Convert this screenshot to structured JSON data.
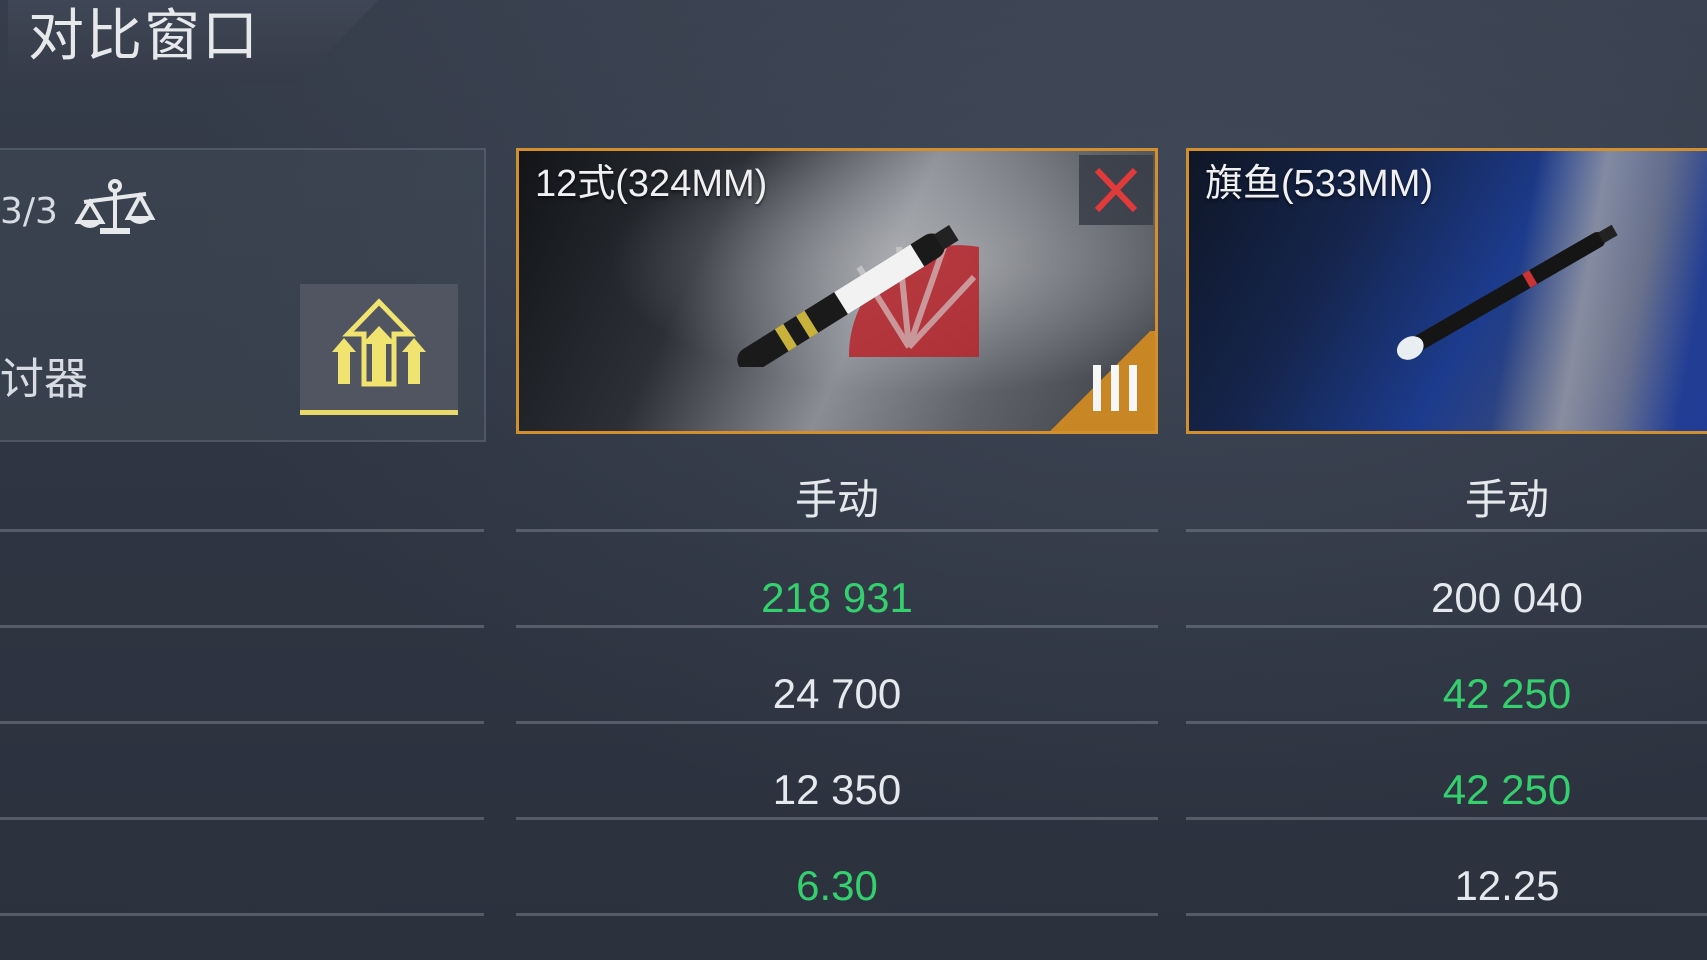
{
  "header": {
    "title": "对比窗口"
  },
  "left_panel": {
    "count": "3/3",
    "weapon_label": "讨器"
  },
  "cards": [
    {
      "name": "12式(324MM)"
    },
    {
      "name": "旗鱼(533MM)"
    }
  ],
  "comparison": {
    "mode": [
      "手动",
      "手动"
    ],
    "stat_1": [
      "218 931",
      "200 040"
    ],
    "stat_2": [
      "24 700",
      "42 250"
    ],
    "stat_3": [
      "12 350",
      "42 250"
    ],
    "stat_4": [
      "6.30",
      "12.25"
    ]
  },
  "colors": {
    "better_value": "#35d06e",
    "normal_value": "#e5e8ec",
    "card_border": "#d1902d",
    "upgrade_accent": "#e8d96a",
    "close_x": "#e03a3a"
  }
}
